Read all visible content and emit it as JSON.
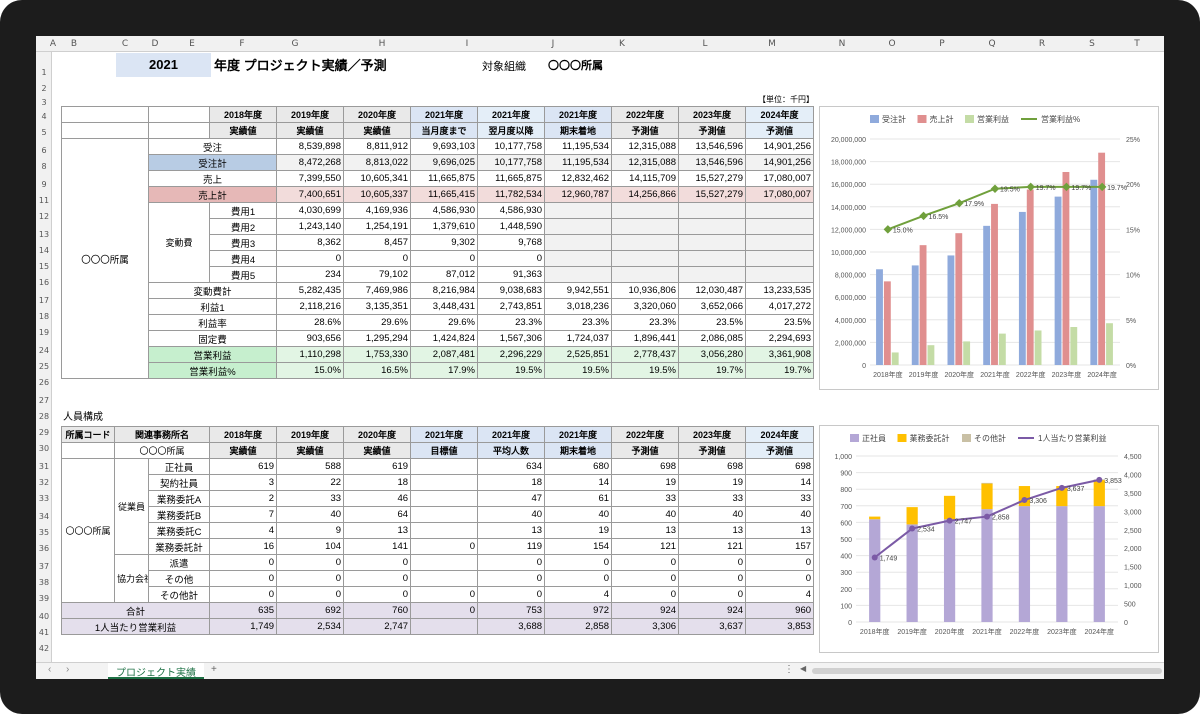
{
  "sheet": {
    "cols": [
      "A",
      "B",
      "C",
      "D",
      "E",
      "F",
      "G",
      "H",
      "I",
      "J",
      "K",
      "L",
      "M",
      "N",
      "O",
      "P",
      "Q",
      "R",
      "S",
      "T"
    ],
    "rows": [
      "1",
      "2",
      "3",
      "4",
      "5",
      "6",
      "8",
      "9",
      "11",
      "12",
      "13",
      "14",
      "15",
      "16",
      "17",
      "18",
      "19",
      "24",
      "25",
      "26",
      "27",
      "28",
      "29",
      "30",
      "31",
      "32",
      "33",
      "34",
      "35",
      "36",
      "37",
      "38",
      "39",
      "40",
      "41",
      "42"
    ]
  },
  "title": {
    "year": "2021",
    "text": "年度 プロジェクト実績／予測",
    "org_label": "対象組織",
    "org_value": "〇〇〇所属",
    "unit": "【単位：千円】"
  },
  "t1": {
    "years": [
      "2018年度",
      "2019年度",
      "2020年度",
      "2021年度",
      "2021年度",
      "2021年度",
      "2022年度",
      "2023年度",
      "2024年度"
    ],
    "subs": [
      "実績値",
      "実績値",
      "実績値",
      "当月度まで",
      "翌月度以降",
      "期末着地",
      "予測値",
      "予測値",
      "予測値"
    ],
    "group": "〇〇〇所属",
    "hensu": "変動費",
    "rows": [
      {
        "l": "受注",
        "v": [
          "8,539,898",
          "8,811,912",
          "9,693,103",
          "10,177,758",
          "11,195,534",
          "12,315,088",
          "13,546,596",
          "14,901,256",
          "16,391,382"
        ]
      },
      {
        "l": "受注計",
        "v": [
          "8,472,268",
          "8,813,022",
          "9,696,025",
          "10,177,758",
          "11,195,534",
          "12,315,088",
          "13,546,596",
          "14,901,256",
          "16,391,382"
        ]
      },
      {
        "l": "売上",
        "v": [
          "7,399,550",
          "10,605,341",
          "11,665,875",
          "11,665,875",
          "12,832,462",
          "14,115,709",
          "15,527,279",
          "17,080,007",
          "18,788,008"
        ]
      },
      {
        "l": "売上計",
        "v": [
          "7,400,651",
          "10,605,337",
          "11,665,415",
          "11,782,534",
          "12,960,787",
          "14,256,866",
          "15,527,279",
          "17,080,007",
          "18,788,008"
        ]
      },
      {
        "l": "費用1",
        "v": [
          "4,030,699",
          "4,169,936",
          "4,586,930",
          "4,586,930",
          "",
          "",
          "",
          "",
          ""
        ]
      },
      {
        "l": "費用2",
        "v": [
          "1,243,140",
          "1,254,191",
          "1,379,610",
          "1,448,590",
          "",
          "",
          "",
          "",
          ""
        ]
      },
      {
        "l": "費用3",
        "v": [
          "8,362",
          "8,457",
          "9,302",
          "9,768",
          "",
          "",
          "",
          "",
          ""
        ]
      },
      {
        "l": "費用4",
        "v": [
          "0",
          "0",
          "0",
          "0",
          "",
          "",
          "",
          "",
          ""
        ]
      },
      {
        "l": "費用5",
        "v": [
          "234",
          "79,102",
          "87,012",
          "91,363",
          "",
          "",
          "",
          "",
          ""
        ]
      },
      {
        "l": "変動費計",
        "v": [
          "5,282,435",
          "7,469,986",
          "8,216,984",
          "9,038,683",
          "9,942,551",
          "10,936,806",
          "12,030,487",
          "13,233,535",
          "14,556,889"
        ]
      },
      {
        "l": "利益1",
        "v": [
          "2,118,216",
          "3,135,351",
          "3,448,431",
          "2,743,851",
          "3,018,236",
          "3,320,060",
          "3,652,066",
          "4,017,272",
          "4,419,000"
        ]
      },
      {
        "l": "利益率",
        "v": [
          "28.6%",
          "29.6%",
          "29.6%",
          "23.3%",
          "23.3%",
          "23.3%",
          "23.5%",
          "23.5%",
          "23.5%"
        ]
      },
      {
        "l": "固定費",
        "v": [
          "903,656",
          "1,295,294",
          "1,424,824",
          "1,567,306",
          "1,724,037",
          "1,896,441",
          "2,086,085",
          "2,294,693",
          "2,524,162"
        ]
      },
      {
        "l": "営業利益",
        "v": [
          "1,110,298",
          "1,753,330",
          "2,087,481",
          "2,296,229",
          "2,525,851",
          "2,778,437",
          "3,056,280",
          "3,361,908",
          "3,698,099"
        ]
      },
      {
        "l": "営業利益%",
        "v": [
          "15.0%",
          "16.5%",
          "17.9%",
          "19.5%",
          "19.5%",
          "19.5%",
          "19.7%",
          "19.7%",
          "19.7%"
        ]
      }
    ]
  },
  "t2": {
    "section": "人員構成",
    "hdr1": "所属コード",
    "hdr2": "関連事務所名",
    "office": "〇〇〇所属",
    "group": "〇〇〇所属",
    "emp": "従業員",
    "kyo": "協力会社",
    "years": [
      "2018年度",
      "2019年度",
      "2020年度",
      "2021年度",
      "2021年度",
      "2021年度",
      "2022年度",
      "2023年度",
      "2024年度"
    ],
    "subs": [
      "実績値",
      "実績値",
      "実績値",
      "目標値",
      "平均人数",
      "期末着地",
      "予測値",
      "予測値",
      "予測値"
    ],
    "rows": [
      {
        "l": "正社員",
        "v": [
          "619",
          "588",
          "619",
          "",
          "634",
          "680",
          "698",
          "698",
          "698"
        ]
      },
      {
        "l": "契約社員",
        "v": [
          "3",
          "22",
          "18",
          "",
          "18",
          "14",
          "19",
          "19",
          "14"
        ]
      },
      {
        "l": "業務委託A",
        "v": [
          "2",
          "33",
          "46",
          "",
          "47",
          "61",
          "33",
          "33",
          "33"
        ]
      },
      {
        "l": "業務委託B",
        "v": [
          "7",
          "40",
          "64",
          "",
          "40",
          "40",
          "40",
          "40",
          "40"
        ]
      },
      {
        "l": "業務委託C",
        "v": [
          "4",
          "9",
          "13",
          "",
          "13",
          "19",
          "13",
          "13",
          "13"
        ]
      },
      {
        "l": "業務委託計",
        "v": [
          "16",
          "104",
          "141",
          "0",
          "119",
          "154",
          "121",
          "121",
          "157"
        ]
      },
      {
        "l": "派遣",
        "v": [
          "0",
          "0",
          "0",
          "",
          "0",
          "0",
          "0",
          "0",
          "0"
        ]
      },
      {
        "l": "その他",
        "v": [
          "0",
          "0",
          "0",
          "",
          "0",
          "0",
          "0",
          "0",
          "0"
        ]
      },
      {
        "l": "その他計",
        "v": [
          "0",
          "0",
          "0",
          "0",
          "0",
          "4",
          "0",
          "0",
          "4"
        ]
      },
      {
        "l": "合計",
        "v": [
          "635",
          "692",
          "760",
          "0",
          "753",
          "972",
          "924",
          "924",
          "960"
        ]
      },
      {
        "l": "1人当たり営業利益",
        "v": [
          "1,749",
          "2,534",
          "2,747",
          "",
          "3,688",
          "2,858",
          "3,306",
          "3,637",
          "3,853"
        ]
      }
    ]
  },
  "tabs": {
    "sheet": "プロジェクト実績",
    "add": "+",
    "left": "‹",
    "right": "›",
    "more": "⋮"
  },
  "chart_data": [
    {
      "type": "bar",
      "categories": [
        "2018年度",
        "2019年度",
        "2020年度",
        "2021年度",
        "2022年度",
        "2023年度",
        "2024年度"
      ],
      "series": [
        {
          "name": "受注計",
          "values": [
            8472268,
            8813022,
            9696025,
            12315088,
            13546596,
            14901256,
            16391382
          ]
        },
        {
          "name": "売上計",
          "values": [
            7400651,
            10605337,
            11665415,
            14256866,
            15527279,
            17080007,
            18788008
          ]
        },
        {
          "name": "営業利益",
          "values": [
            1110298,
            1753330,
            2087481,
            2778437,
            3056280,
            3361908,
            3698099
          ]
        },
        {
          "name": "営業利益%",
          "type": "line",
          "values": [
            15.0,
            16.5,
            17.9,
            19.5,
            19.7,
            19.7,
            19.7
          ]
        }
      ],
      "labels": [
        "15.0%",
        "16.5%",
        "17.9%",
        "19.5%",
        "19.7%",
        "19.7%",
        "19.7%"
      ],
      "yticks": [
        "20,000,000",
        "18,000,000",
        "16,000,000",
        "14,000,000",
        "12,000,000",
        "10,000,000",
        "8,000,000",
        "6,000,000",
        "4,000,000",
        "2,000,000",
        "0"
      ],
      "y2ticks": [
        "25%",
        "20%",
        "15%",
        "10%",
        "5%",
        "0%"
      ],
      "ylim": [
        0,
        20000000
      ],
      "y2lim": [
        0,
        25
      ],
      "colors": [
        "#8faadc",
        "#e08f8f",
        "#c4dca6",
        "#70a03c"
      ],
      "legend": "top"
    },
    {
      "type": "bar",
      "categories": [
        "2018年度",
        "2019年度",
        "2020年度",
        "2021年度",
        "2022年度",
        "2023年度",
        "2024年度"
      ],
      "series": [
        {
          "name": "正社員",
          "values": [
            619,
            588,
            619,
            680,
            698,
            698,
            698
          ]
        },
        {
          "name": "業務委託計",
          "values": [
            16,
            104,
            141,
            154,
            121,
            121,
            157
          ]
        },
        {
          "name": "その他計",
          "values": [
            0,
            0,
            0,
            4,
            0,
            0,
            4
          ]
        },
        {
          "name": "1人当たり営業利益",
          "type": "line",
          "values": [
            1749,
            2534,
            2747,
            2858,
            3306,
            3637,
            3853
          ]
        }
      ],
      "labels": [
        "1,749",
        "2,534",
        "2,747",
        "2,858",
        "3,306",
        "3,637",
        "3,853"
      ],
      "yticks": [
        "1,000",
        "900",
        "800",
        "700",
        "600",
        "500",
        "400",
        "300",
        "200",
        "100",
        "0"
      ],
      "y2ticks": [
        "4,500",
        "4,000",
        "3,500",
        "3,000",
        "2,500",
        "2,000",
        "1,500",
        "1,000",
        "500",
        "0"
      ],
      "ylim": [
        0,
        1000
      ],
      "y2lim": [
        0,
        4500
      ],
      "colors": [
        "#b4a7d6",
        "#ffc000",
        "#c9c0a5",
        "#7b5aa6"
      ],
      "legend": "top"
    }
  ]
}
